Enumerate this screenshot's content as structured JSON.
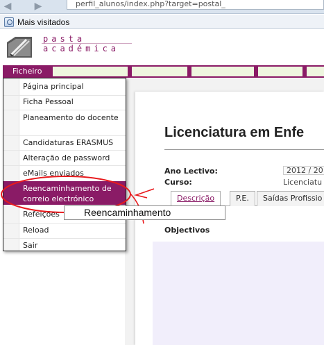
{
  "bookmarks": {
    "label": "Mais visitados",
    "icon": "bookmark-icon"
  },
  "browser": {
    "url_fragment": "perfil_alunos/index.php?target=postal_"
  },
  "brand": {
    "line1": "pasta",
    "line2": "académica",
    "color": "#8a1b66"
  },
  "nav": {
    "menu_label": "Ficheiro"
  },
  "menu": {
    "items": [
      {
        "label": "Página principal"
      },
      {
        "label": "Ficha Pessoal"
      },
      {
        "label": "Planeamento do docente"
      },
      {
        "label": "Candidaturas ERASMUS"
      },
      {
        "label": "Alteração de password"
      },
      {
        "label": "eMails enviados"
      },
      {
        "label": "Reencaminhamento de correio electrónico"
      },
      {
        "label": "Refeições"
      },
      {
        "label": "Reload"
      },
      {
        "label": "Sair"
      }
    ]
  },
  "page": {
    "title": "Licenciatura em Enfe",
    "ano_label": "Ano Lectivo:",
    "ano_value": "2012 / 20",
    "curso_label": "Curso:",
    "curso_value": "Licenciatu",
    "tabs": [
      {
        "label": "Descrição"
      },
      {
        "label": "P.E."
      },
      {
        "label": "Saídas Profissio"
      }
    ],
    "section_title": "Objectivos"
  },
  "annotation": {
    "callout_text": "Reencaminhamento",
    "color": "#e8191c"
  }
}
